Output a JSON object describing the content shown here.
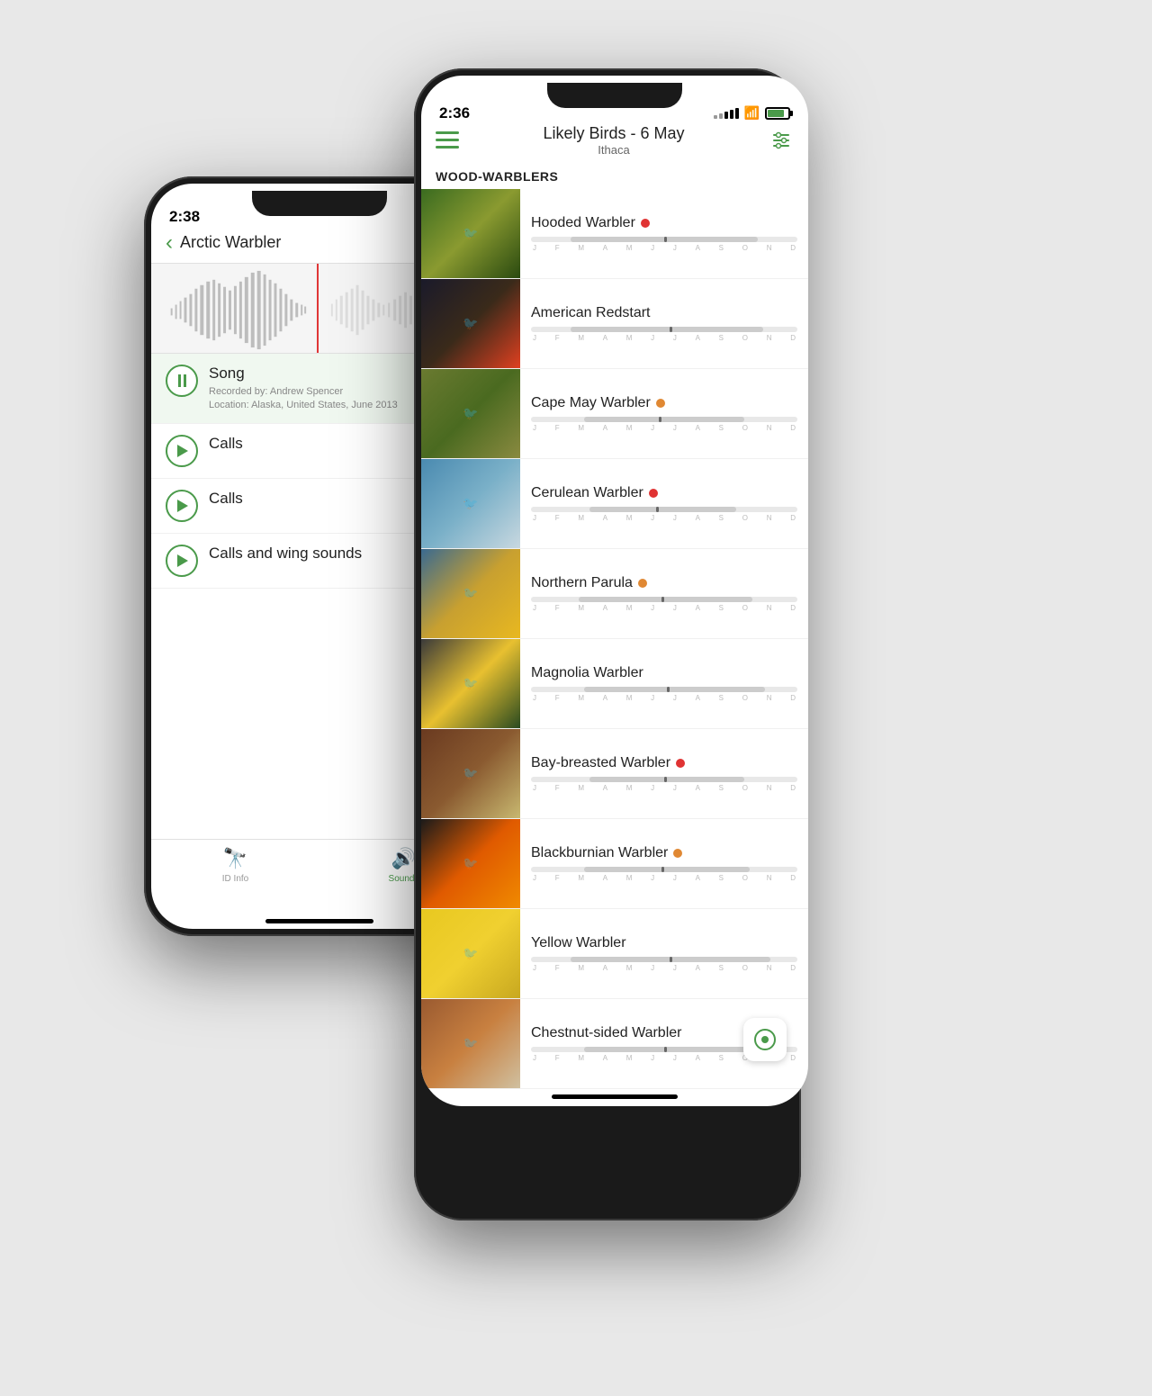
{
  "back_phone": {
    "time": "2:38",
    "title": "Arctic Warbler",
    "sounds": [
      {
        "id": "song",
        "name": "Song",
        "type": "active",
        "meta_line1": "Recorded by: Andrew Spencer",
        "meta_line2": "Location: Alaska, United States, June 2013"
      },
      {
        "id": "calls1",
        "name": "Calls",
        "type": "play",
        "meta_line1": "",
        "meta_line2": ""
      },
      {
        "id": "calls2",
        "name": "Calls",
        "type": "play",
        "meta_line1": "",
        "meta_line2": ""
      },
      {
        "id": "calls_wing",
        "name": "Calls and wing sounds",
        "type": "play",
        "meta_line1": "",
        "meta_line2": ""
      }
    ],
    "tabs": [
      {
        "id": "id_info",
        "label": "ID Info",
        "active": false
      },
      {
        "id": "sounds",
        "label": "Sounds",
        "active": true
      }
    ]
  },
  "front_phone": {
    "time": "2:36",
    "title": "Likely Birds - 6 May",
    "subtitle": "Ithaca",
    "section": "WOOD-WARBLERS",
    "birds": [
      {
        "name": "Hooded Warbler",
        "status": "red",
        "bar_left": "15%",
        "bar_width": "70%",
        "peak_pos": "50%",
        "thumb_class": "bt-hooded"
      },
      {
        "name": "American Redstart",
        "status": "none",
        "bar_left": "15%",
        "bar_width": "72%",
        "peak_pos": "52%",
        "thumb_class": "bt-redstart"
      },
      {
        "name": "Cape May Warbler",
        "status": "orange",
        "bar_left": "20%",
        "bar_width": "60%",
        "peak_pos": "48%",
        "thumb_class": "bt-capemay"
      },
      {
        "name": "Cerulean Warbler",
        "status": "red",
        "bar_left": "22%",
        "bar_width": "55%",
        "peak_pos": "47%",
        "thumb_class": "bt-cerulean"
      },
      {
        "name": "Northern Parula",
        "status": "orange",
        "bar_left": "18%",
        "bar_width": "65%",
        "peak_pos": "49%",
        "thumb_class": "bt-parula"
      },
      {
        "name": "Magnolia Warbler",
        "status": "none",
        "bar_left": "20%",
        "bar_width": "68%",
        "peak_pos": "51%",
        "thumb_class": "bt-magnolia"
      },
      {
        "name": "Bay-breasted Warbler",
        "status": "red",
        "bar_left": "22%",
        "bar_width": "58%",
        "peak_pos": "50%",
        "thumb_class": "bt-baybreasted"
      },
      {
        "name": "Blackburnian Warbler",
        "status": "orange",
        "bar_left": "20%",
        "bar_width": "62%",
        "peak_pos": "49%",
        "thumb_class": "bt-blackburnian"
      },
      {
        "name": "Yellow Warbler",
        "status": "none",
        "bar_left": "15%",
        "bar_width": "75%",
        "peak_pos": "52%",
        "thumb_class": "bt-yellow"
      },
      {
        "name": "Chestnut-sided Warbler",
        "status": "none",
        "bar_left": "20%",
        "bar_width": "68%",
        "peak_pos": "50%",
        "thumb_class": "bt-chestnutsided"
      }
    ],
    "month_labels": [
      "J",
      "F",
      "M",
      "A",
      "M",
      "J",
      "J",
      "A",
      "S",
      "O",
      "N",
      "D"
    ]
  },
  "icons": {
    "back_arrow": "‹",
    "play": "▶",
    "pause": "⏸",
    "hamburger": "☰",
    "filter": "⚙",
    "binoculars": "🔭",
    "sound": "🔊"
  }
}
